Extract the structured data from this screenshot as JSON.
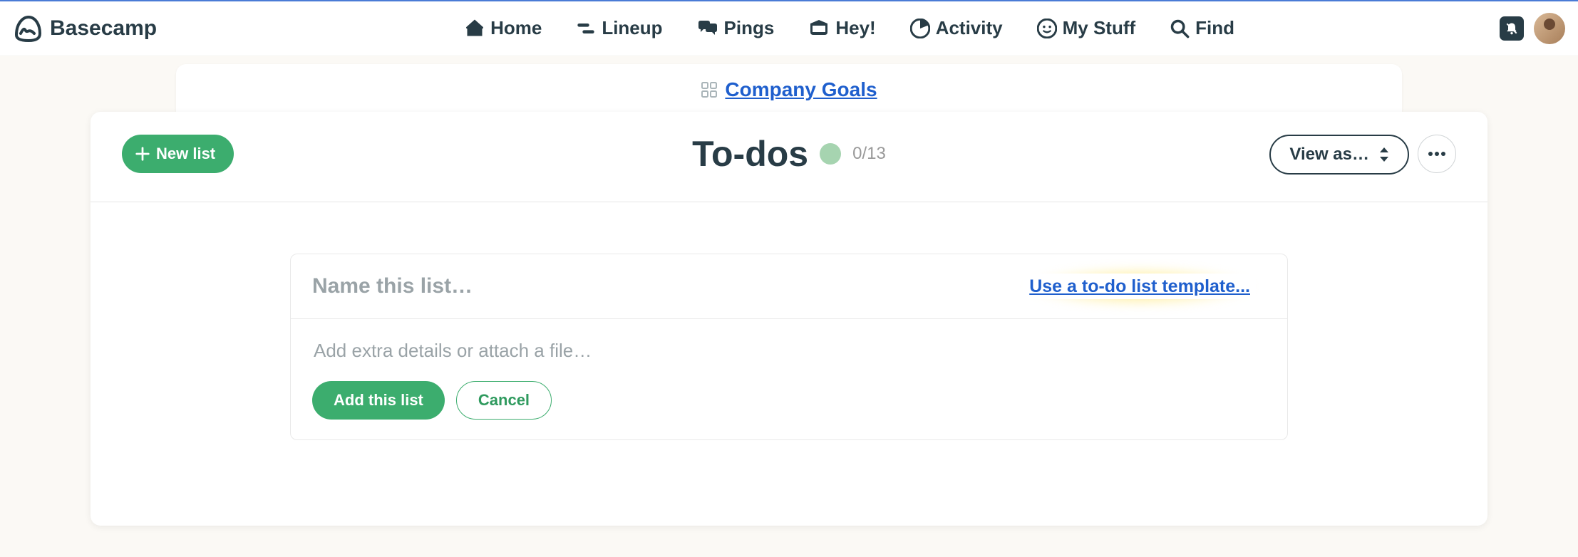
{
  "brand": {
    "name": "Basecamp"
  },
  "nav": {
    "items": [
      {
        "label": "Home"
      },
      {
        "label": "Lineup"
      },
      {
        "label": "Pings"
      },
      {
        "label": "Hey!"
      },
      {
        "label": "Activity"
      },
      {
        "label": "My Stuff"
      },
      {
        "label": "Find"
      }
    ]
  },
  "breadcrumb": {
    "project": "Company Goals"
  },
  "header": {
    "new_list_label": "New list",
    "title": "To-dos",
    "count": "0/13",
    "view_as_label": "View as…"
  },
  "form": {
    "name_placeholder": "Name this list…",
    "template_link": "Use a to-do list template...",
    "details_placeholder": "Add extra details or attach a file…",
    "add_label": "Add this list",
    "cancel_label": "Cancel"
  }
}
